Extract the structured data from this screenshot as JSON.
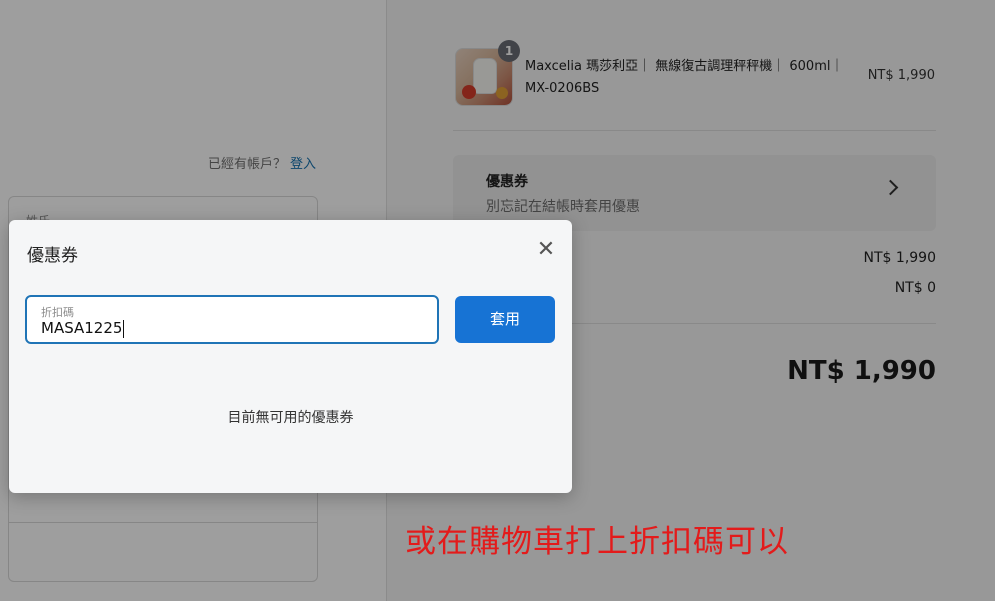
{
  "account": {
    "hint": "已經有帳戶？",
    "login_link": "登入"
  },
  "form": {
    "first_placeholder": "姓氏"
  },
  "product": {
    "name": "Maxcelia 瑪莎利亞｜ 無線復古調理秤秤機｜ 600ml｜ MX-0206BS",
    "price": "NT$ 1,990",
    "quantity": "1"
  },
  "coupon_card": {
    "title": "優惠券",
    "subtitle": "別忘記在結帳時套用優惠"
  },
  "summary": {
    "subtotal": "NT$ 1,990",
    "shipping": "NT$ 0",
    "total": "NT$ 1,990"
  },
  "modal": {
    "title": "優惠券",
    "close_icon": "close-icon",
    "field_label": "折扣碼",
    "field_value": "MASA1225",
    "apply_label": "套用",
    "empty_message": "目前無可用的優惠券"
  },
  "annotation": {
    "text": "或在購物車打上折扣碼可以",
    "color": "#e31b1b"
  },
  "colors": {
    "accent": "#1773d4",
    "focus_border": "#1f74b6"
  }
}
